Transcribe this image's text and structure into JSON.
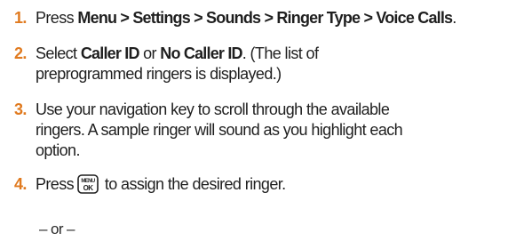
{
  "steps": [
    {
      "number": "1.",
      "parts": [
        "Press ",
        "Menu > Settings > Sounds > Ringer Type > Voice Calls",
        "."
      ]
    },
    {
      "number": "2.",
      "line1_parts": [
        "Select ",
        "Caller ID",
        " or ",
        "No Caller ID",
        ". (The list of"
      ],
      "line2": "preprogrammed ringers is displayed.)"
    },
    {
      "number": "3.",
      "line1": "Use your navigation key to scroll through the available",
      "line2": "ringers. A sample ringer will sound as you highlight each",
      "line3": "option."
    },
    {
      "number": "4.",
      "before_key": "Press ",
      "key_label_top": "MENU",
      "key_label_bottom": "OK",
      "after_key": " to assign the desired ringer."
    }
  ],
  "or_text": "– or –",
  "colors": {
    "step_number": "#e07a1f",
    "text": "#1f1f1f"
  },
  "icons": {
    "menu_ok_key": "menu-ok-key-icon"
  }
}
